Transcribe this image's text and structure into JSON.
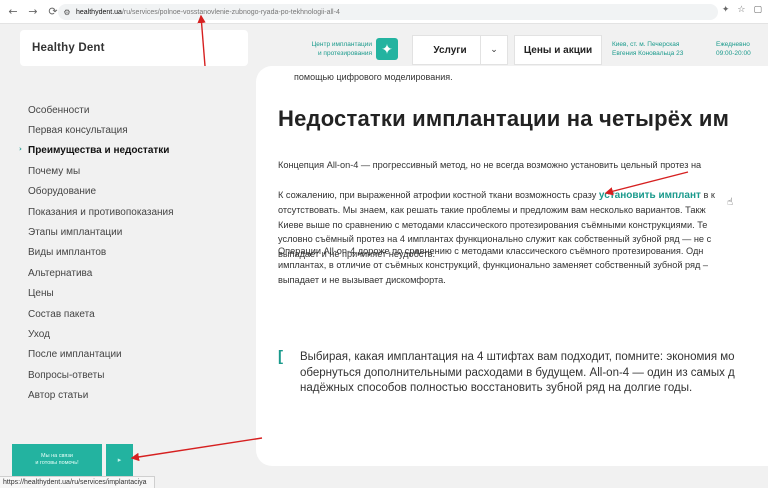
{
  "browser": {
    "back": "←",
    "forward": "→",
    "reload": "⟳",
    "url_host": "healthydent.ua",
    "url_path": "/ru/services/polnoe-vosstanovlenie-zubnogo-ryada-po-tekhnologii-all-4",
    "right_icons": [
      "✦",
      "☆",
      "▢"
    ]
  },
  "header": {
    "logo": "Healthy Dent",
    "clinic_tag_line1": "Центр имплантации",
    "clinic_tag_line2": "и протезирования",
    "star_icon": "✦",
    "services_label": "Услуги",
    "dropdown_icon": "⌄",
    "prices_label": "Цены и акции",
    "address_line1": "Киев, ст. м. Печерская",
    "address_line2": "Евгения Коновальца 23",
    "hours_line1": "Ежедневно",
    "hours_line2": "09:00-20:00"
  },
  "sidebar": {
    "items": [
      {
        "label": "Особенности"
      },
      {
        "label": "Первая консультация"
      },
      {
        "label": "Преимущества и недостатки"
      },
      {
        "label": "Почему мы"
      },
      {
        "label": "Оборудование"
      },
      {
        "label": "Показания и противопоказания"
      },
      {
        "label": "Этапы имплантации"
      },
      {
        "label": "Виды имплантов"
      },
      {
        "label": "Альтернатива"
      },
      {
        "label": "Цены"
      },
      {
        "label": "Состав пакета"
      },
      {
        "label": "Уход"
      },
      {
        "label": "После имплантации"
      },
      {
        "label": "Вопросы-ответы"
      },
      {
        "label": "Автор статьи"
      }
    ],
    "active_marker": "›"
  },
  "content": {
    "prev_tail": "помощью цифрового моделирования.",
    "heading": "Недостатки имплантации на четырёх им",
    "p1": "Концепция All-on-4 — прогрессивный метод, но не всегда возможно установить цельный протез на",
    "p2_line1_before": "К сожалению, при выраженной атрофии костной ткани возможность сразу ",
    "p2_link": "установить имплант",
    "p2_line1_after": " в к",
    "p2_line2": "отсутствовать. Мы знаем, как решать такие проблемы и предложим вам несколько вариантов. Такж",
    "p2_line3": "Киеве выше по сравнению с методами классического протезирования съёмными конструкциями. Те",
    "p2_line4": "условно съёмный протез на 4 имплантах функционально служит как собственный зубной ряд — не с",
    "p2_line5": "выпадает и не причиняет неудобств.",
    "p3_line1": "Операции All-on-4 дороже по сравнению с методами классического съёмного протезирования. Одн",
    "p3_line2": "имплантах, в отличие от съёмных конструкций, функционально заменяет собственный зубной ряд –",
    "p3_line3": "выпадает и не вызывает дискомфорта.",
    "quote_bracket": "[",
    "quote_line1": "Выбирая, какая имплантация на 4 штифтах вам подходит, помните: экономия мо",
    "quote_line2": "обернуться дополнительными расходами в будущем. All-on-4 — один из самых д",
    "quote_line3": "надёжных способов полностью восстановить зубной ряд на долгие годы."
  },
  "widget": {
    "line1": "Мы на связи",
    "line2": "и готовы помочь!",
    "side_icon": "▸"
  },
  "statusbar": {
    "url": "https://healthydent.ua/ru/services/implantaciya"
  }
}
